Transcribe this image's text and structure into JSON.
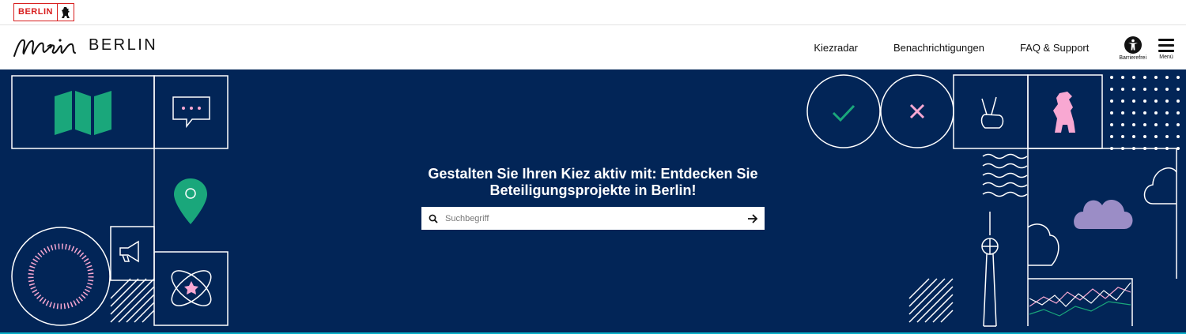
{
  "topbar": {
    "badge_label": "BERLIN"
  },
  "header": {
    "logo_script": "mein",
    "logo_text": "BERLIN",
    "nav": [
      {
        "label": "Kiezradar"
      },
      {
        "label": "Benachrichtigungen"
      },
      {
        "label": "FAQ & Support"
      }
    ],
    "accessibility_label": "Barrierefrei",
    "menu_label": "Menü"
  },
  "hero": {
    "title": "Gestalten Sie Ihren Kiez aktiv mit: Entdecken Sie Beteiligungsprojekte in Berlin!",
    "search": {
      "placeholder": "Suchbegriff",
      "value": ""
    }
  },
  "colors": {
    "navy": "#022557",
    "green": "#1aa77b",
    "pink": "#f8a8d2",
    "purple": "#9b8dc6",
    "red": "#d81e1e"
  }
}
